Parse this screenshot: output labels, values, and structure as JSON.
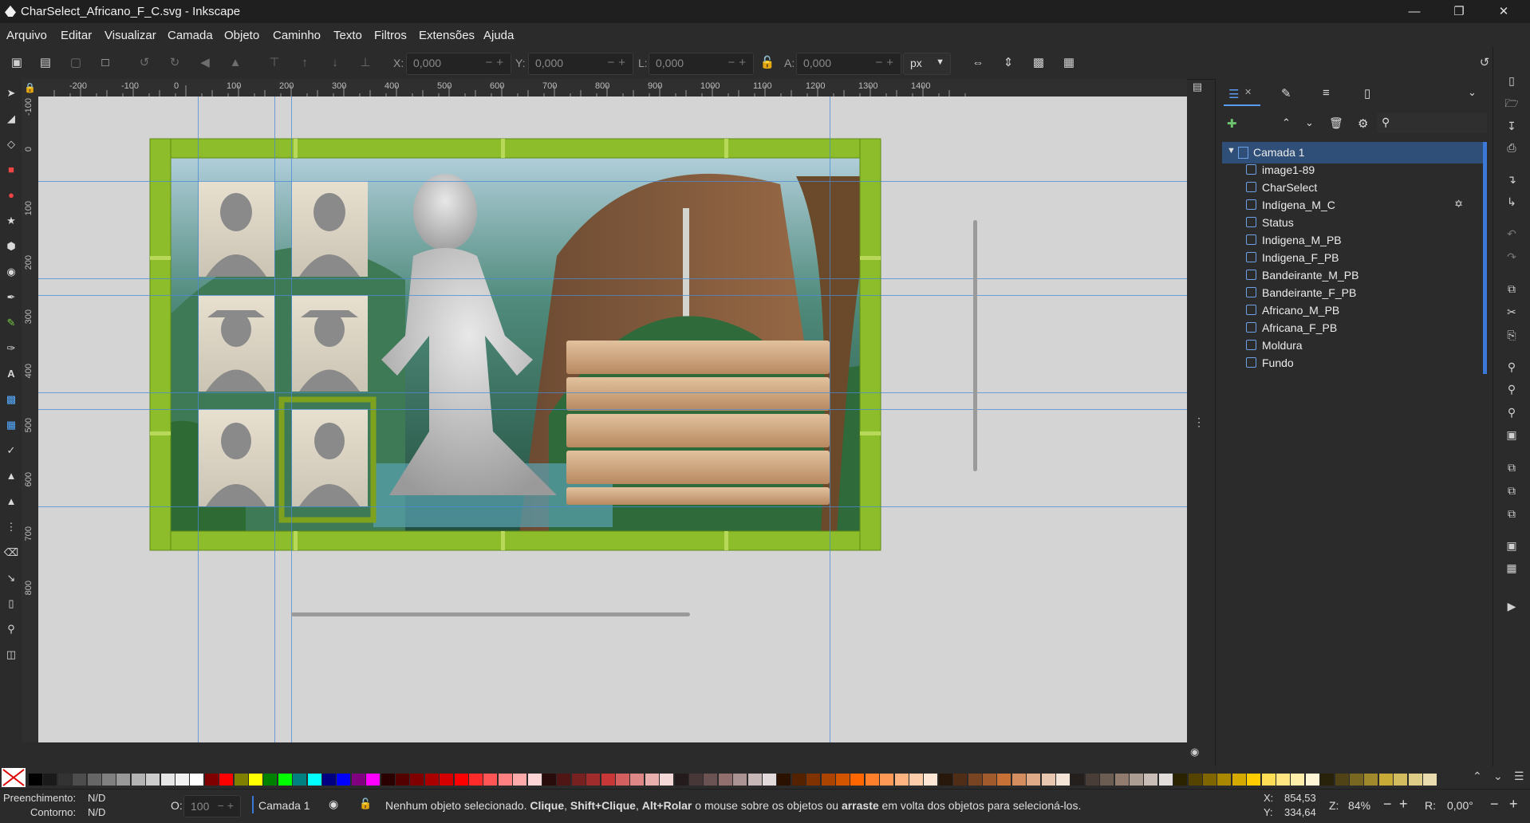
{
  "window": {
    "title": "CharSelect_Africano_F_C.svg - Inkscape",
    "min_icon": "minimize-icon",
    "max_icon": "restore-icon",
    "close_icon": "close-icon"
  },
  "menu": [
    "Arquivo",
    "Editar",
    "Visualizar",
    "Camada",
    "Objeto",
    "Caminho",
    "Texto",
    "Filtros",
    "Extensões",
    "Ajuda"
  ],
  "toolbar": {
    "x_label": "X:",
    "x_value": "0,000",
    "y_label": "Y:",
    "y_value": "0,000",
    "l_label": "L:",
    "l_value": "0,000",
    "a_label": "A:",
    "a_value": "0,000",
    "unit": "px"
  },
  "ruler": {
    "h_ticks": [
      "-200",
      "-100",
      "0",
      "100",
      "200",
      "300",
      "400",
      "500",
      "600",
      "700",
      "800",
      "900",
      "1000",
      "1100",
      "1200",
      "1300",
      "1400"
    ],
    "v_ticks": [
      "-100",
      "0",
      "100",
      "200",
      "300",
      "400",
      "500",
      "600",
      "700",
      "800"
    ]
  },
  "layers": {
    "layer_name": "Camada 1",
    "items": [
      "image1-89",
      "CharSelect",
      "Indígena_M_C",
      "Status",
      "Indigena_M_PB",
      "Indigena_F_PB",
      "Bandeirante_M_PB",
      "Bandeirante_F_PB",
      "Africano_M_PB",
      "Africana_F_PB",
      "Moldura",
      "Fundo"
    ]
  },
  "status": {
    "fill_label": "Preenchimento:",
    "fill_value": "N/D",
    "stroke_label": "Contorno:",
    "stroke_value": "N/D",
    "opacity_label": "O:",
    "opacity_value": "100",
    "layer": "Camada 1",
    "message_prefix": "Nenhum objeto selecionado. ",
    "message_b1": "Clique",
    "message_s1": ", ",
    "message_b2": "Shift+Clique",
    "message_s2": ", ",
    "message_b3": "Alt+Rolar",
    "message_s3": " o mouse sobre os objetos ou ",
    "message_b4": "arraste",
    "message_s4": " em volta dos objetos para selecioná-los.",
    "x_label": "X:",
    "x_value": "854,53",
    "y_label": "Y:",
    "y_value": "334,64",
    "z_label": "Z:",
    "zoom": "84%",
    "r_label": "R:",
    "rotation": "0,00°"
  },
  "colors": {
    "accent": "#3c78d8",
    "guide": "#4a8ad4",
    "bamboo": "#8dbd2a",
    "wood": "#c9a27a"
  },
  "palette": [
    "#000000",
    "#1a1a1a",
    "#333333",
    "#4d4d4d",
    "#666666",
    "#808080",
    "#999999",
    "#b3b3b3",
    "#cccccc",
    "#e6e6e6",
    "#f2f2f2",
    "#ffffff",
    "#800000",
    "#ff0000",
    "#808000",
    "#ffff00",
    "#008000",
    "#00ff00",
    "#008080",
    "#00ffff",
    "#000080",
    "#0000ff",
    "#800080",
    "#ff00ff",
    "#2b0000",
    "#550000",
    "#800000",
    "#aa0000",
    "#d40000",
    "#ff0000",
    "#ff2a2a",
    "#ff5555",
    "#ff8080",
    "#ffaaaa",
    "#ffd5d5",
    "#280b0b",
    "#501616",
    "#782121",
    "#a02c2c",
    "#c83737",
    "#d35f5f",
    "#de8787",
    "#e9afaf",
    "#f4d7d7",
    "#241c1c",
    "#483737",
    "#6c5353",
    "#916f6f",
    "#ac9393",
    "#c8b7b7",
    "#e3dbdb",
    "#2b1100",
    "#552200",
    "#803300",
    "#aa4400",
    "#d45500",
    "#ff6600",
    "#ff7f2a",
    "#ff9955",
    "#ffb380",
    "#ffccaa",
    "#ffe6d5",
    "#28170b",
    "#502d16",
    "#784421",
    "#a05a2c",
    "#c87137",
    "#d38d5f",
    "#deaa87",
    "#e9c6af",
    "#f4e3d7",
    "#241f1c",
    "#483e37",
    "#6c5d53",
    "#917c6f",
    "#ac9d93",
    "#c8beb7",
    "#e3dedb",
    "#2b2200",
    "#554400",
    "#806600",
    "#aa8800",
    "#d4aa00",
    "#ffcc00",
    "#ffdd55",
    "#ffe680",
    "#ffeeaa",
    "#fff6d5",
    "#28220b",
    "#504416",
    "#786721",
    "#a0892c",
    "#c8ab37",
    "#d3bc5f",
    "#decd87",
    "#e9ddaf"
  ],
  "canvas_scene": {
    "labels": "none"
  }
}
